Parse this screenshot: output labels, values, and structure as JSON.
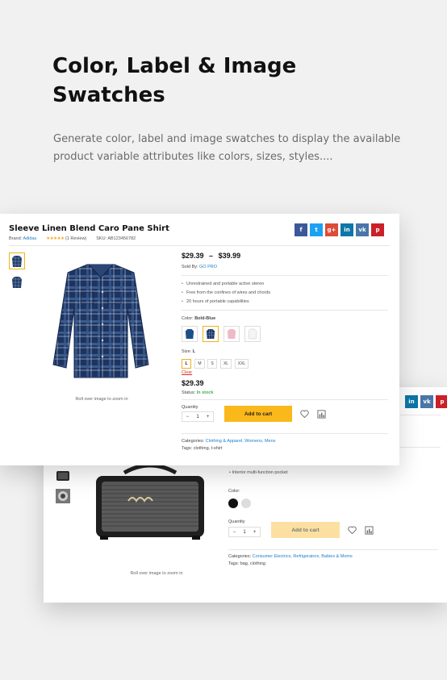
{
  "promo": {
    "headline": "Color, Label & Image Swatches",
    "description": "Generate color, label and image swatches to display the available product variable attributes like colors, sizes, styles...."
  },
  "front": {
    "title": "Sleeve Linen Blend Caro Pane Shirt",
    "brand_label": "Brand:",
    "brand": "Adidas",
    "rating": "★★★★★",
    "reviews": "(1 Review)",
    "sku_label": "SKU:",
    "sku": "AB123456782",
    "social": [
      "f",
      "t",
      "g+",
      "in",
      "vk",
      "p"
    ],
    "price_low": "$29.39",
    "price_dash": "–",
    "price_high": "$39.99",
    "sold_by_label": "Sold By:",
    "sold_by": "GO PRO",
    "features": [
      "Unrestrained and portable active stereo",
      "Free from the confines of wires and chords",
      "20 hours of portable capabilities"
    ],
    "color_label": "Color:",
    "color_value": "Bold-Blue",
    "size_label": "Size:",
    "size_value": "L",
    "sizes": [
      "L",
      "M",
      "S",
      "XL",
      "XXL"
    ],
    "clear": "Clear",
    "price": "$29.39",
    "status_label": "Status:",
    "status": "In stock",
    "quantity_label": "Quantity",
    "minus": "−",
    "qty": "1",
    "plus": "+",
    "add_to_cart": "Add to cart",
    "categories_label": "Categories:",
    "categories": "Clothing & Apparel, Womens, Mens",
    "tags_label": "Tags:",
    "tags": "clothing, t-shirt",
    "zoom": "Roll over image to zoom in"
  },
  "back": {
    "social": [
      "in",
      "vk",
      "p"
    ],
    "feature_partial": "Interior multi-function pocket",
    "color_label": "Color:",
    "quantity_label": "Quantity",
    "minus": "−",
    "qty": "1",
    "plus": "+",
    "add_to_cart": "Add to cart",
    "categories_label": "Categories:",
    "categories": "Consumer Electrics, Refrigerators, Babies & Moms",
    "tags_label": "Tags:",
    "tags": "bag, clothing",
    "zoom": "Roll over image to zoom in"
  },
  "colors": {
    "accent": "#f0b21b",
    "link": "#1e7ec8",
    "in_stock": "#4caf50",
    "clear": "#d9302c",
    "facebook": "#3b5998",
    "twitter": "#1da1f2",
    "google": "#dd4b39",
    "linkedin": "#0e76a8",
    "vk": "#4a76a8",
    "pinterest": "#cb2027"
  }
}
